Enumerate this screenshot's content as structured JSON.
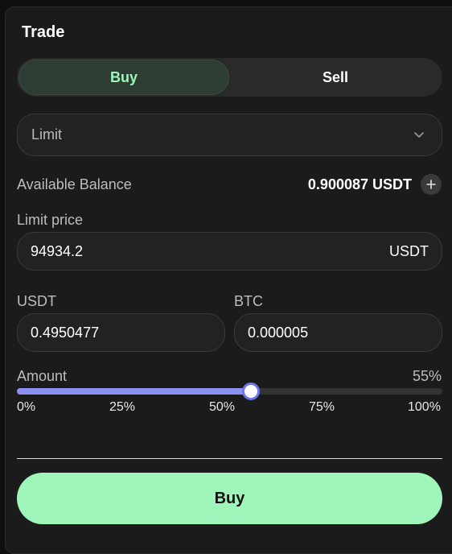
{
  "trade": {
    "title": "Trade",
    "side_toggle": {
      "buy_label": "Buy",
      "sell_label": "Sell",
      "selected": "Buy"
    },
    "order_type": {
      "selected": "Limit"
    },
    "balance": {
      "label": "Available Balance",
      "value": "0.900087 USDT"
    },
    "limit_price": {
      "label": "Limit price",
      "value": "94934.2",
      "unit": "USDT"
    },
    "usdt": {
      "label": "USDT",
      "value": "0.4950477"
    },
    "btc": {
      "label": "BTC",
      "value": "0.000005"
    },
    "amount": {
      "label": "Amount",
      "percent_label": "55%",
      "percent": 55,
      "ticks": [
        "0%",
        "25%",
        "50%",
        "75%",
        "100%"
      ]
    },
    "submit_label": "Buy"
  },
  "colors": {
    "accent_green": "#9ff5ba",
    "slider_fill": "#8a91ee",
    "panel_bg": "#1b1b1b"
  },
  "icons": {
    "dropdown": "chevron-down-icon",
    "add": "plus-icon"
  }
}
